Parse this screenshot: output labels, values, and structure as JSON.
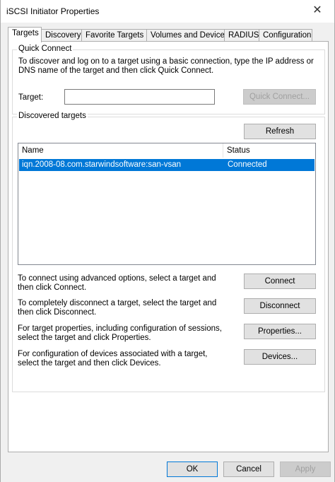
{
  "window": {
    "title": "iSCSI Initiator Properties",
    "close_glyph": "✕"
  },
  "tabs": [
    {
      "label": "Targets",
      "active": true
    },
    {
      "label": "Discovery"
    },
    {
      "label": "Favorite Targets"
    },
    {
      "label": "Volumes and Devices"
    },
    {
      "label": "RADIUS"
    },
    {
      "label": "Configuration"
    }
  ],
  "quick_connect": {
    "group_label": "Quick Connect",
    "description": "To discover and log on to a target using a basic connection, type the IP address or DNS name of the target and then click Quick Connect.",
    "target_label": "Target:",
    "target_value": "",
    "button_label": "Quick Connect..."
  },
  "discovered": {
    "group_label": "Discovered targets",
    "refresh_label": "Refresh",
    "columns": [
      "Name",
      "Status"
    ],
    "rows": [
      {
        "name": "iqn.2008-08.com.starwindsoftware:san-vsan",
        "status": "Connected",
        "selected": true
      }
    ],
    "actions": [
      {
        "text": "To connect using advanced options, select a target and then click Connect.",
        "button": "Connect"
      },
      {
        "text": "To completely disconnect a target, select the target and then click Disconnect.",
        "button": "Disconnect"
      },
      {
        "text": "For target properties, including configuration of sessions, select the target and click Properties.",
        "button": "Properties..."
      },
      {
        "text": "For configuration of devices associated with a target, select the target and then click Devices.",
        "button": "Devices..."
      }
    ]
  },
  "footer": {
    "ok": "OK",
    "cancel": "Cancel",
    "apply": "Apply"
  }
}
